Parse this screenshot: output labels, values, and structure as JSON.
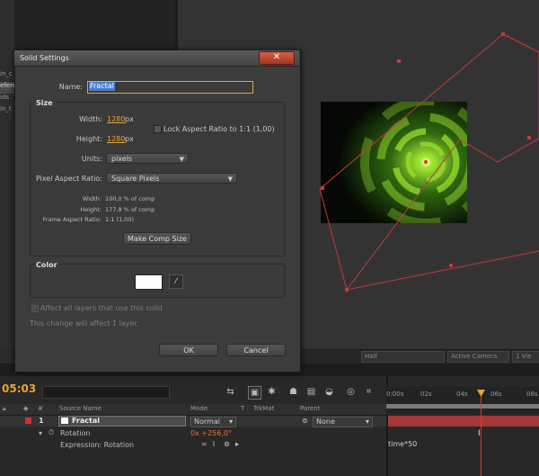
{
  "left_panel": {
    "items": [
      "in_c",
      "efere",
      "ids",
      "in_t"
    ]
  },
  "viewer": {
    "bottom_bar": {
      "resolution": "Half",
      "camera": "Active Camera",
      "views": "1 Vie"
    },
    "layer_glow_color": "#9be02e"
  },
  "dialog": {
    "title": "Solid Settings",
    "close": "✕",
    "name_label": "Name:",
    "name_value": "Fractal",
    "size": {
      "title": "Size",
      "width_label": "Width:",
      "width_value": "1280",
      "width_unit": "px",
      "height_label": "Height:",
      "height_value": "1280",
      "height_unit": "px",
      "lock_label": "Lock Aspect Ratio to 1:1 (1,00)",
      "units_label": "Units:",
      "units_value": "pixels",
      "par_label": "Pixel Aspect Ratio:",
      "par_value": "Square Pixels",
      "info_width_label": "Width:",
      "info_width_value": "100,0 % of comp",
      "info_height_label": "Height:",
      "info_height_value": "177,8 % of comp",
      "info_far_label": "Frame Aspect Ratio:",
      "info_far_value": "1:1 (1,00)",
      "make_comp_size": "Make Comp Size"
    },
    "color": {
      "title": "Color",
      "swatch": "#ffffff"
    },
    "affect_label": "Affect all layers that use this solid",
    "affect_note": "This change will affect 1 layer.",
    "ok": "OK",
    "cancel": "Cancel"
  },
  "timeline": {
    "timecode": "05:03",
    "columns": {
      "num": "#",
      "source_name": "Source Name",
      "mode": "Mode",
      "t": "T",
      "trkmat": "TrkMat",
      "parent": "Parent"
    },
    "ruler": [
      "0:00s",
      "02s",
      "04s",
      "06s",
      "08s"
    ],
    "layer": {
      "number": "1",
      "name": "Fractal",
      "mode": "Normal",
      "parent": "None"
    },
    "rotation_label": "Rotation",
    "rotation_value": "0x +256,0°",
    "expression_label": "Expression: Rotation",
    "expression_text": "time*50",
    "label_color": "#cc3333"
  }
}
